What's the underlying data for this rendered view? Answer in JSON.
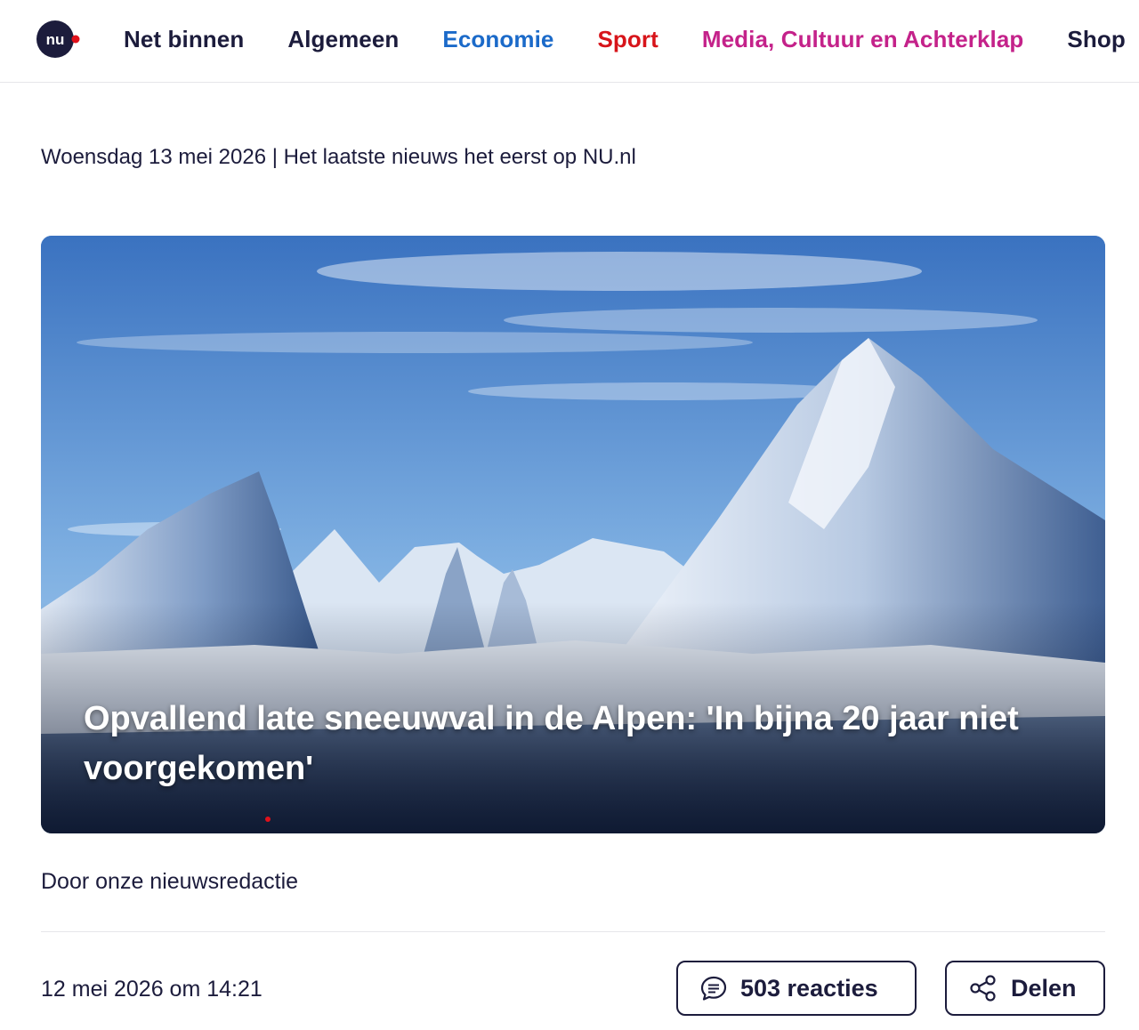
{
  "colors": {
    "brand_navy": "#1c1c3c",
    "brand_red": "#e0111b",
    "economie": "#1b6ac9",
    "sport": "#d7141a",
    "media": "#c4228a",
    "divider": "#e6e6ea"
  },
  "header": {
    "logo_icon": "nu-logo-icon",
    "nav": [
      {
        "label": "Net binnen",
        "color": "#1c1c3c"
      },
      {
        "label": "Algemeen",
        "color": "#1c1c3c"
      },
      {
        "label": "Economie",
        "color": "#1b6ac9"
      },
      {
        "label": "Sport",
        "color": "#d7141a"
      },
      {
        "label": "Media, Cultuur en Achterklap",
        "color": "#c4228a"
      },
      {
        "label": "Shop",
        "color": "#1c1c3c"
      }
    ]
  },
  "date_line": "Woensdag 13 mei 2026 | Het laatste nieuws het eerst op NU.nl",
  "article": {
    "title": "Opvallend late sneeuwval in de Alpen: 'In bijna 20 jaar niet voorgekomen'",
    "byline": "Door onze nieuwsredactie",
    "published": "12 mei 2026 om 14:21",
    "comments_label": "503 reacties",
    "comments_icon": "speech-bubble-icon",
    "share_label": "Delen",
    "share_icon": "share-icon"
  }
}
